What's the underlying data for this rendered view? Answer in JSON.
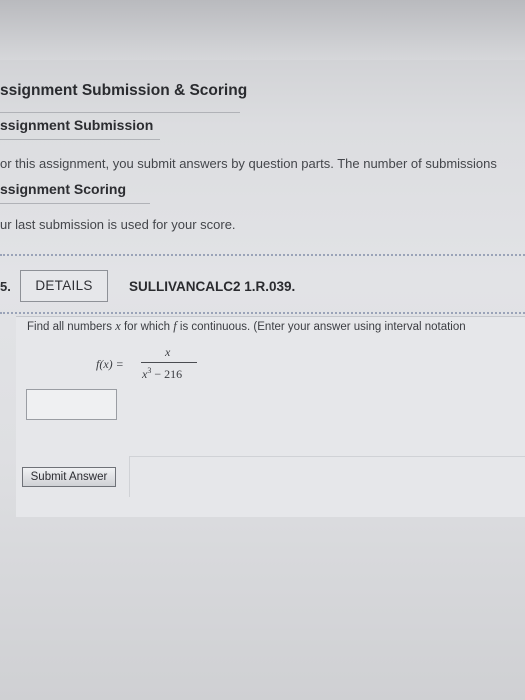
{
  "section": {
    "title": "ssignment Submission & Scoring"
  },
  "submission": {
    "heading": "ssignment Submission",
    "text": "or this assignment, you submit answers by question parts. The number of submissions"
  },
  "scoring": {
    "heading": "ssignment Scoring",
    "text": "ur last submission is used for your score."
  },
  "question": {
    "number": "5.",
    "details_label": "DETAILS",
    "id": "SULLIVANCALC2 1.R.039.",
    "prompt_pre": "Find all numbers",
    "prompt_var_x": "x",
    "prompt_mid": "for which",
    "prompt_var_f": "f",
    "prompt_post": "is continuous. (Enter your answer using interval notation",
    "formula": {
      "lhs": "f(x) =",
      "numerator": "x",
      "denominator_base": "x",
      "denominator_exponent": "3",
      "denominator_rest": " − 216"
    },
    "answer_value": "",
    "submit_label": "Submit Answer"
  }
}
